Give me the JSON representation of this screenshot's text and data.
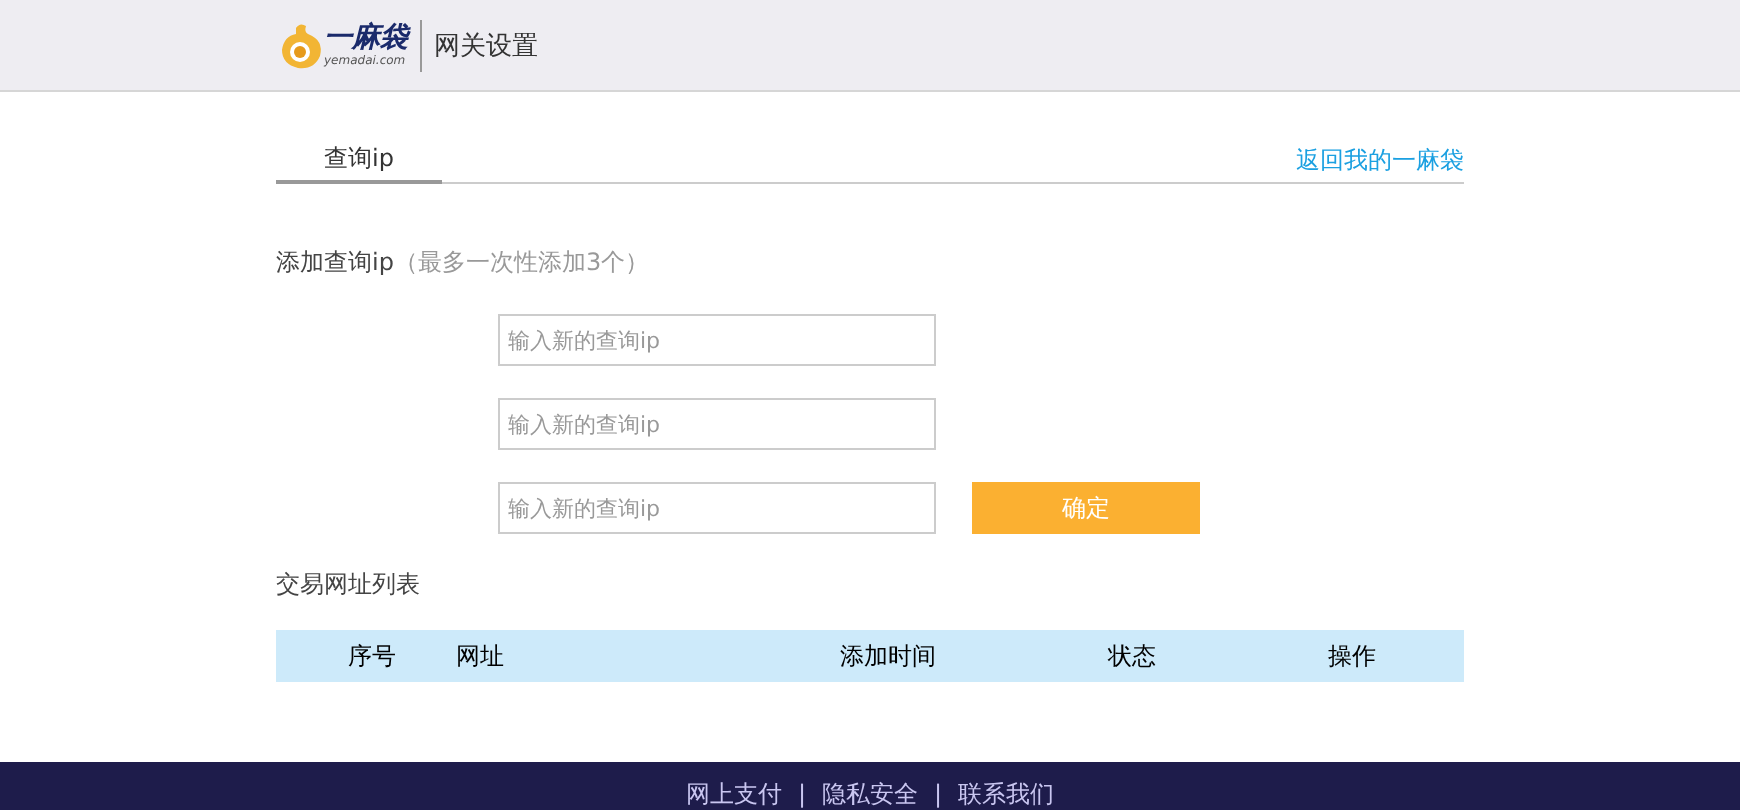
{
  "header": {
    "logo": {
      "name": "一麻袋",
      "domain": "yemadai.com"
    },
    "title": "网关设置"
  },
  "tabs": [
    {
      "label": "查询ip",
      "selected": true
    }
  ],
  "back_link": "返回我的一麻袋",
  "add_section": {
    "label": "添加查询ip",
    "hint": "（最多一次性添加3个）",
    "fields": [
      {
        "placeholder": "输入新的查询ip"
      },
      {
        "placeholder": "输入新的查询ip"
      },
      {
        "placeholder": "输入新的查询ip"
      }
    ],
    "button": "确定"
  },
  "list": {
    "title": "交易网址列表",
    "columns": [
      "序号",
      "网址",
      "添加时间",
      "状态",
      "操作"
    ]
  },
  "footer": {
    "links": [
      "网上支付",
      "隐私安全",
      "联系我们"
    ],
    "separators": [
      "|",
      "|"
    ]
  }
}
